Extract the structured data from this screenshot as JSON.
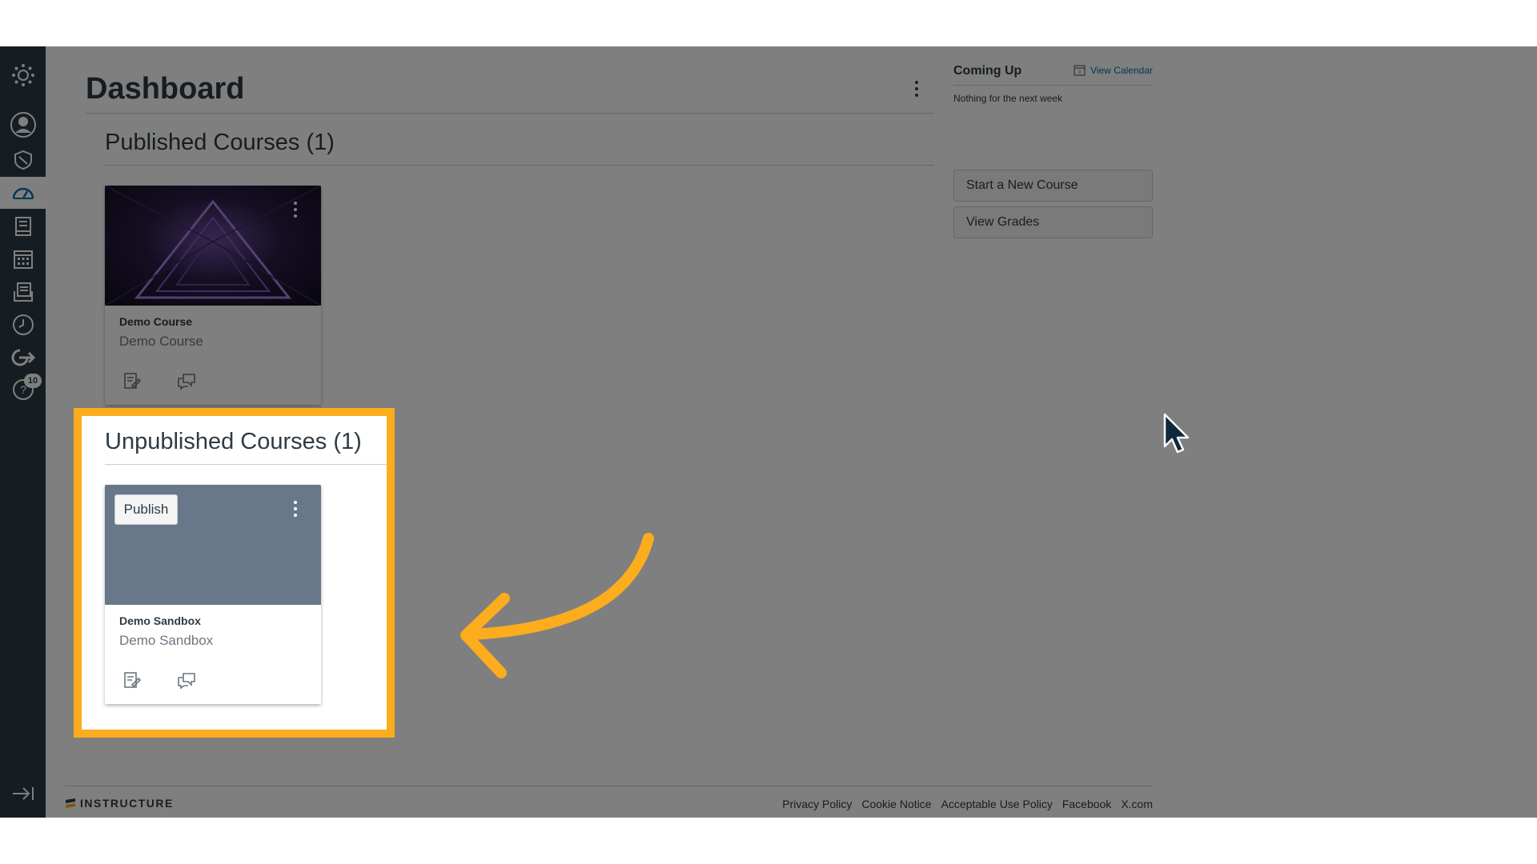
{
  "global_nav": {
    "items": [
      {
        "name": "logo",
        "icon": "canvas-logo-icon"
      },
      {
        "name": "account",
        "icon": "user-avatar-icon"
      },
      {
        "name": "admin",
        "icon": "shield-icon"
      },
      {
        "name": "dashboard",
        "icon": "dashboard-icon"
      },
      {
        "name": "courses",
        "icon": "book-icon"
      },
      {
        "name": "calendar",
        "icon": "calendar-icon"
      },
      {
        "name": "inbox",
        "icon": "inbox-icon"
      },
      {
        "name": "history",
        "icon": "clock-icon"
      },
      {
        "name": "commons",
        "icon": "share-arrow-icon"
      },
      {
        "name": "help",
        "icon": "help-icon",
        "badge": "10"
      }
    ],
    "collapse_icon": "collapse-nav-icon"
  },
  "header": {
    "title": "Dashboard"
  },
  "published": {
    "title": "Published Courses (1)",
    "courses": [
      {
        "code": "Demo Course",
        "name": "Demo Course"
      }
    ]
  },
  "unpublished": {
    "title": "Unpublished Courses (1)",
    "publish_label": "Publish",
    "courses": [
      {
        "code": "Demo Sandbox",
        "name": "Demo Sandbox"
      }
    ]
  },
  "sidebar": {
    "coming_up": "Coming Up",
    "view_calendar": "View Calendar",
    "nothing": "Nothing for the next week",
    "start_course": "Start a New Course",
    "view_grades": "View Grades"
  },
  "footer": {
    "logo_text": "INSTRUCTURE",
    "links": [
      "Privacy Policy",
      "Cookie Notice",
      "Acceptable Use Policy",
      "Facebook",
      "X.com"
    ]
  },
  "colors": {
    "nav_bg": "#2d3b45",
    "highlight": "#fbad1d",
    "link": "#0770a3",
    "unpublished_card": "#68778a"
  }
}
